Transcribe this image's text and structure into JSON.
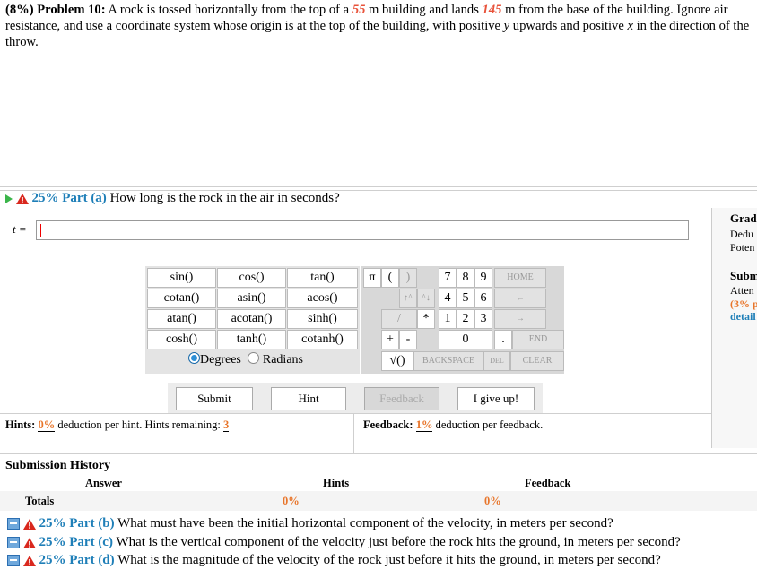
{
  "problem": {
    "prefix": "(8%) Problem 10:",
    "t1": " A rock is tossed horizontally from the top of a ",
    "height": "55",
    "t2": " m building and lands ",
    "distance": "145",
    "t3": " m from the base of the building. Ignore air resistance, and use a coordinate system whose origin is at the top of the building, with positive ",
    "y": "y",
    "t4": " upwards and positive ",
    "x": "x",
    "t5": " in the direction of the throw."
  },
  "part_a": {
    "pct": "25% Part (a)",
    "question": "How long is the rock in the air in seconds?",
    "var_label": "t ="
  },
  "side": {
    "l1": "Grad",
    "l2": "Dedu",
    "l3": "Poten",
    "l4": "Subm",
    "l5": "Atten",
    "l6": "(3% p",
    "l7": "detail"
  },
  "fn_buttons": [
    "sin()",
    "cos()",
    "tan()",
    "cotan()",
    "asin()",
    "acos()",
    "atan()",
    "acotan()",
    "sinh()",
    "cosh()",
    "tanh()",
    "cotanh()"
  ],
  "angle": {
    "degrees": "Degrees",
    "radians": "Radians"
  },
  "keypad": {
    "pi": "π",
    "lp": "(",
    "rp": ")",
    "k7": "7",
    "k8": "8",
    "k9": "9",
    "home": "HOME",
    "up": "↑^",
    "dn": "^↓",
    "k4": "4",
    "k5": "5",
    "k6": "6",
    "left": "←",
    "div": "/",
    "mul": "*",
    "k1": "1",
    "k2": "2",
    "k3": "3",
    "right": "→",
    "plus": "+",
    "minus": "-",
    "k0": "0",
    "dot": ".",
    "end": "END",
    "sqrt": "√()",
    "backspace": "BACKSPACE",
    "del": "DEL",
    "clear": "CLEAR"
  },
  "actions": {
    "submit": "Submit",
    "hint": "Hint",
    "feedback": "Feedback",
    "giveup": "I give up!"
  },
  "hints": {
    "label": "Hints:",
    "pct": "0%",
    "text1": " deduction per hint. Hints remaining: ",
    "remaining": "3"
  },
  "feedback": {
    "label": "Feedback:",
    "pct": "1%",
    "text": " deduction per feedback."
  },
  "history": {
    "title": "Submission History",
    "col_answer": "Answer",
    "col_hints": "Hints",
    "col_feedback": "Feedback",
    "totals": "Totals",
    "hints_total": "0%",
    "feedback_total": "0%"
  },
  "parts": [
    {
      "pct": "25% Part (b)",
      "question": "What must have been the initial horizontal component of the velocity, in meters per second?"
    },
    {
      "pct": "25% Part (c)",
      "question": "What is the vertical component of the velocity just before the rock hits the ground, in meters per second?"
    },
    {
      "pct": "25% Part (d)",
      "question": "What is the magnitude of the velocity of the rock just before it hits the ground, in meters per second?"
    }
  ],
  "colors": {
    "accent": "#1f7fb8",
    "value": "#e8523a",
    "orange": "#e8752a",
    "play": "#3bb54a",
    "warning": "#d9281e"
  }
}
